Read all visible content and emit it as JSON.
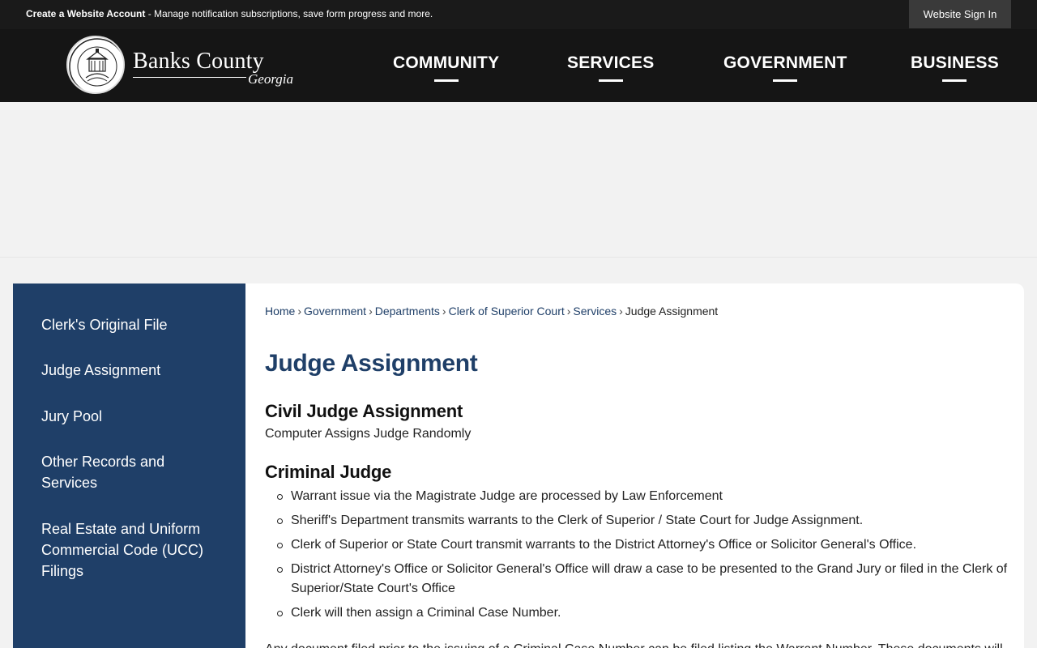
{
  "topbar": {
    "create_account_link": "Create a Website Account",
    "create_account_text": " - Manage notification subscriptions, save form progress and more.",
    "sign_in": "Website Sign In"
  },
  "logo": {
    "county": "Banks County",
    "state": "Georgia"
  },
  "nav": {
    "items": [
      {
        "label": "COMMUNITY"
      },
      {
        "label": "SERVICES"
      },
      {
        "label": "GOVERNMENT"
      },
      {
        "label": "BUSINESS"
      }
    ]
  },
  "sidebar": {
    "items": [
      {
        "label": "Clerk's Original File"
      },
      {
        "label": "Judge Assignment"
      },
      {
        "label": "Jury Pool"
      },
      {
        "label": "Other Records and Services"
      },
      {
        "label": "Real Estate and Uniform Commercial Code (UCC) Filings"
      }
    ]
  },
  "breadcrumb": {
    "items": [
      "Home",
      "Government",
      "Departments",
      "Clerk of Superior Court",
      "Services"
    ],
    "separator": "›",
    "current": "Judge Assignment"
  },
  "main": {
    "title": "Judge Assignment",
    "civil_heading": "Civil Judge Assignment",
    "civil_text": "Computer Assigns Judge Randomly",
    "criminal_heading": "Criminal Judge",
    "criminal_list": [
      "Warrant issue via the Magistrate Judge are processed by Law Enforcement",
      "Sheriff's Department transmits warrants to the Clerk of Superior / State Court for Judge Assignment.",
      "Clerk of Superior or State Court transmit warrants to the District Attorney's Office or Solicitor General's Office.",
      "District Attorney's Office or Solicitor General's Office will draw a case to be presented to the Grand Jury or filed in the Clerk of Superior/State Court's Office",
      "Clerk will then assign a Criminal Case Number."
    ],
    "tail_text": "Any document filed prior to the issuing of a Criminal Case Number can be filed listing the Warrant Number. These documents will"
  },
  "colors": {
    "accent": "#1f3f68",
    "topbar": "#1a1a1a",
    "header": "#151515"
  }
}
